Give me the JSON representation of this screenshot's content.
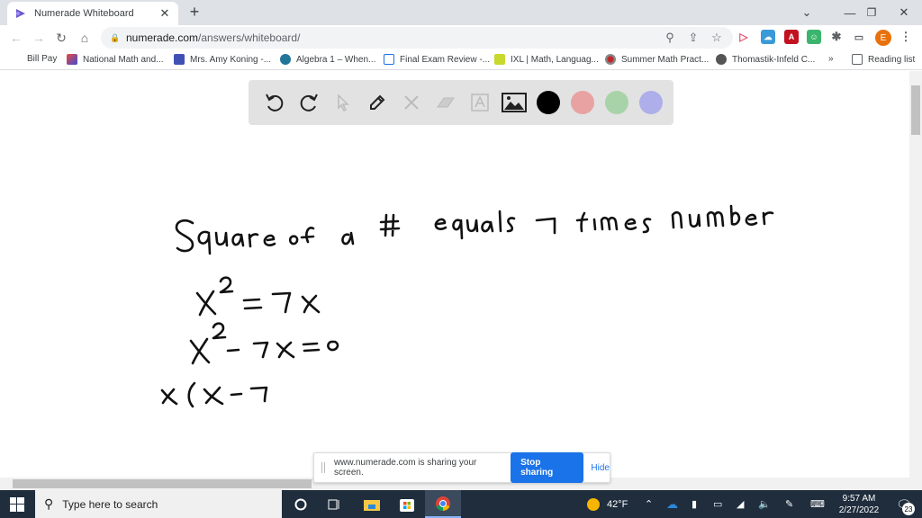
{
  "browser": {
    "tab": {
      "title": "Numerade Whiteboard",
      "favicon": "numerade-logo-icon"
    },
    "url_host": "numerade.com",
    "url_path": "/answers/whiteboard/",
    "bookmarks": [
      {
        "label": "Bill Pay",
        "icon": "none"
      },
      {
        "label": "National Math and...",
        "icon": "national-math-icon"
      },
      {
        "label": "Mrs. Amy Koning -...",
        "icon": "calendar-icon"
      },
      {
        "label": "Algebra 1 – When...",
        "icon": "wordpress-icon"
      },
      {
        "label": "Final Exam Review -...",
        "icon": "doc-icon"
      },
      {
        "label": "IXL | Math, Languag...",
        "icon": "ixl-icon"
      },
      {
        "label": "Summer Math Pract...",
        "icon": "record-icon"
      },
      {
        "label": "Thomastik-Infeld C...",
        "icon": "globe-icon"
      }
    ],
    "more_bookmarks": "»",
    "reading_list": "Reading list",
    "profile_initial": "E"
  },
  "whiteboard": {
    "tools": [
      "undo-icon",
      "redo-icon",
      "select-icon",
      "pen-icon",
      "tools-icon",
      "eraser-icon",
      "text-icon",
      "image-icon"
    ],
    "colors": [
      "#000000",
      "#e8a2a2",
      "#a8d3a8",
      "#aeaeea"
    ],
    "handwriting": {
      "line1": "Square of a # equals 7 times number",
      "line2": "x² = 7x",
      "line3": "x² - 7x = 0",
      "line4": "x(x-7"
    }
  },
  "share_bar": {
    "message": "www.numerade.com is sharing your screen.",
    "stop_label": "Stop sharing",
    "hide_label": "Hide"
  },
  "taskbar": {
    "search_placeholder": "Type here to search",
    "weather": "42°F",
    "time": "9:57 AM",
    "date": "2/27/2022",
    "notifications": "23"
  }
}
